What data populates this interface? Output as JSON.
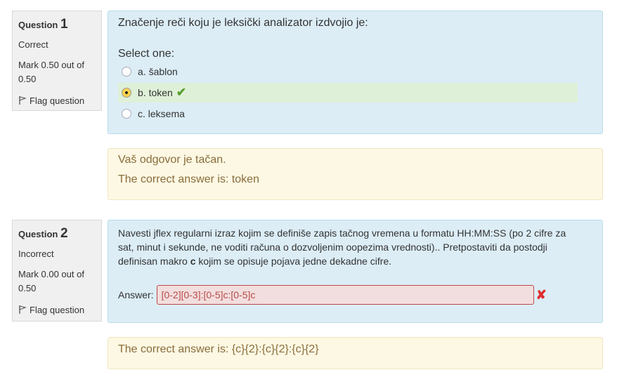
{
  "q1": {
    "label": "Question",
    "number": "1",
    "state": "Correct",
    "grade": "Mark 0.50 out of 0.50",
    "flag_label": "Flag question",
    "text": "Značenje reči koju je leksički analizator izdvojio je:",
    "select_prompt": "Select one:",
    "options": [
      {
        "label": "a. šablon",
        "selected": false,
        "correct": false
      },
      {
        "label": "b. token",
        "selected": true,
        "correct": true
      },
      {
        "label": "c. leksema",
        "selected": false,
        "correct": false
      }
    ],
    "feedback": "Vaš odgovor je tačan.",
    "right_answer": "The correct answer is: token"
  },
  "q2": {
    "label": "Question",
    "number": "2",
    "state": "Incorrect",
    "grade": "Mark 0.00 out of 0.50",
    "flag_label": "Flag question",
    "text_before": "Navesti jflex regularni izraz kojim se definiše zapis tačnog vremena u formatu HH:MM:SS (po 2 cifre za sat, minut i sekunde, ne voditi računa o dozvoljenim oopezima vrednosti).. Pretpostaviti da postodji definisan makro ",
    "text_bold": "c",
    "text_after": " kojim se opisuje pojava jedne dekadne cifre.",
    "answer_label": "Answer:",
    "answer_value": "[0-2][0-3]:[0-5]c:[0-5]c",
    "right_answer": "The correct answer is: {c}{2}:{c}{2}:{c}{2}"
  },
  "colors": {
    "info_bg": "#f0f0f0",
    "formulation_bg": "#dcedf6",
    "feedback_bg": "#fcf8e3",
    "correct_bg": "#dff0d8",
    "incorrect_bg": "#f2dede",
    "check": "#5aa02c",
    "cross": "#e02d2d"
  }
}
